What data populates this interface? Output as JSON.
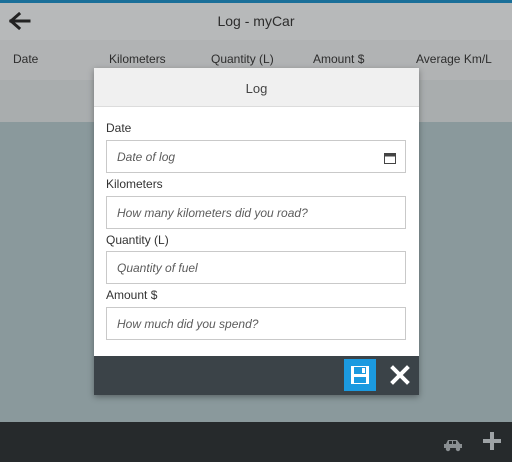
{
  "app": {
    "title": "Log - myCar"
  },
  "icons": {
    "back": "arrow-left-icon",
    "car": "car-icon",
    "add": "plus-icon",
    "calendar": "calendar-icon",
    "save": "floppy-disk-icon",
    "close": "close-icon"
  },
  "columns": [
    "Date",
    "Kilometers",
    "Quantity (L)",
    "Amount $",
    "Average Km/L"
  ],
  "modal": {
    "title": "Log",
    "fields": [
      {
        "label": "Date",
        "placeholder": "Date of log",
        "value": ""
      },
      {
        "label": "Kilometers",
        "placeholder": "How many kilometers did you road?",
        "value": ""
      },
      {
        "label": "Quantity (L)",
        "placeholder": "Quantity of fuel",
        "value": ""
      },
      {
        "label": "Amount $",
        "placeholder": "How much did you spend?",
        "value": ""
      }
    ]
  },
  "colors": {
    "accent": "#1b9ae0",
    "topbar_border": "#1a6f99",
    "footer": "#3b4348",
    "bottombar": "#262a2c"
  }
}
